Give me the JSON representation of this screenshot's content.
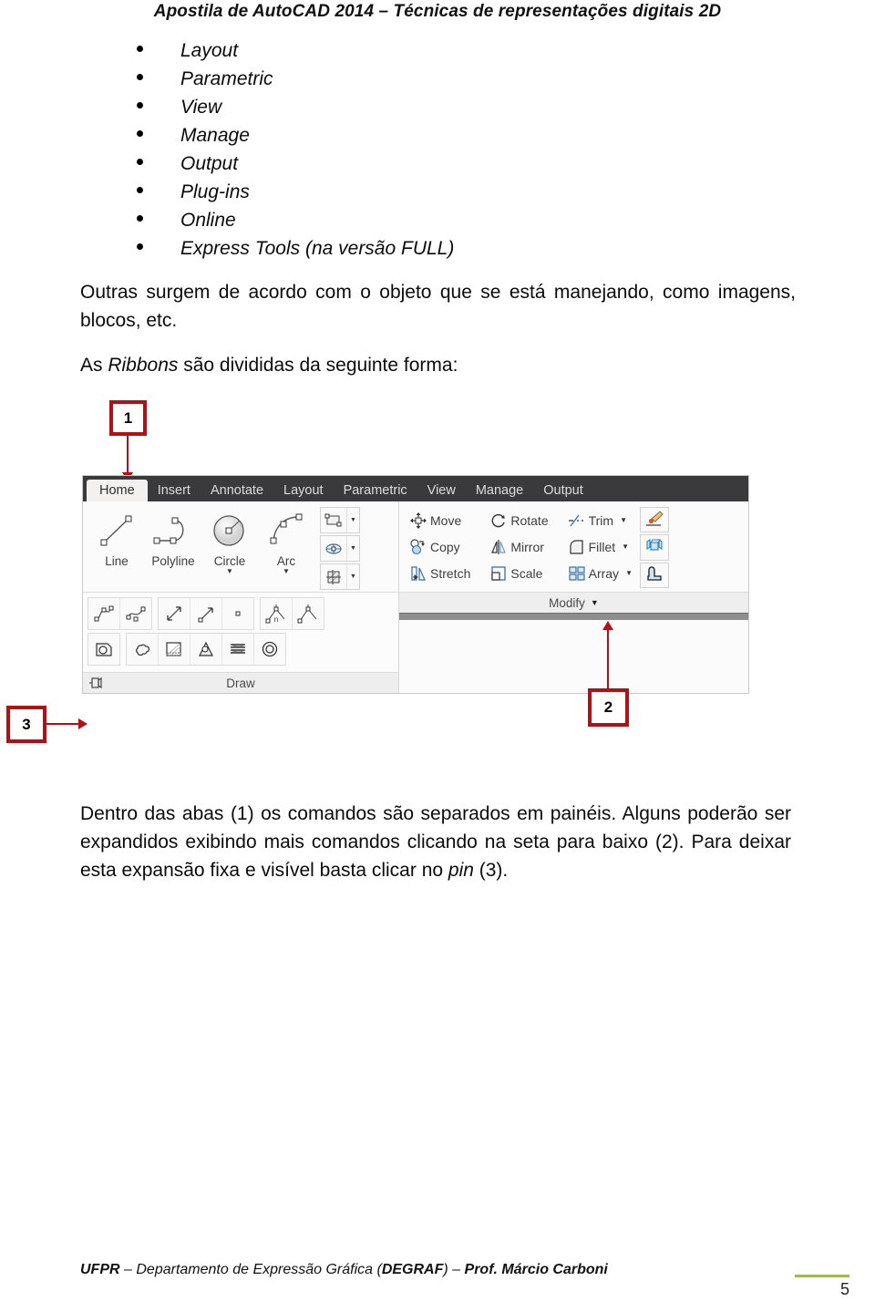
{
  "document": {
    "header": "Apostila de AutoCAD 2014 – Técnicas de representações digitais 2D",
    "footer": "UFPR – Departamento de Expressão Gráfica (DEGRAF) – Prof. Márcio Carboni",
    "footer_parts": {
      "inst": "UFPR",
      "sep1": " – ",
      "dept": "Departamento de Expressão Gráfica (",
      "acronym": "DEGRAF",
      "close": ")",
      "sep2": " – ",
      "author": "Prof. Márcio Carboni"
    },
    "page_number": "5",
    "accent_green": "#9bbb59",
    "callout_red": "#b01116"
  },
  "bullets": [
    {
      "label": "Layout"
    },
    {
      "label": "Parametric"
    },
    {
      "label": "View"
    },
    {
      "label": "Manage"
    },
    {
      "label": "Output"
    },
    {
      "label": "Plug-ins"
    },
    {
      "label": "Online"
    },
    {
      "label": "Express Tools (na versão FULL)"
    }
  ],
  "paragraphs": {
    "p1": "Outras surgem de acordo com o objeto que se está manejando, como imagens, blocos, etc.",
    "p2_pre": "As ",
    "p2_em": "Ribbons",
    "p2_post": " são divididas da seguinte forma:",
    "p3_a": "Dentro das abas (1) os comandos são separados em painéis. Alguns poderão ser expandidos exibindo mais comandos clicando na seta para baixo (2). Para deixar esta expansão fixa e visível basta clicar no ",
    "p3_em": "pin",
    "p3_b": " (3)."
  },
  "callouts": [
    {
      "id": "1",
      "label": "1",
      "points_to": "Home tab"
    },
    {
      "id": "2",
      "label": "2",
      "points_to": "Modify panel expand arrow"
    },
    {
      "id": "3",
      "label": "3",
      "points_to": "Draw panel pin"
    }
  ],
  "ribbon": {
    "tabs": [
      {
        "label": "Home",
        "active": true
      },
      {
        "label": "Insert",
        "active": false
      },
      {
        "label": "Annotate",
        "active": false
      },
      {
        "label": "Layout",
        "active": false
      },
      {
        "label": "Parametric",
        "active": false
      },
      {
        "label": "View",
        "active": false
      },
      {
        "label": "Manage",
        "active": false
      },
      {
        "label": "Output",
        "active": false
      }
    ],
    "draw_panel": {
      "title": "Draw",
      "big_tools": [
        {
          "label": "Line",
          "has_dropdown": false,
          "icon": "line-icon"
        },
        {
          "label": "Polyline",
          "has_dropdown": false,
          "icon": "polyline-icon"
        },
        {
          "label": "Circle",
          "has_dropdown": true,
          "icon": "circle-icon"
        },
        {
          "label": "Arc",
          "has_dropdown": true,
          "icon": "arc-icon"
        }
      ],
      "small_tools": [
        {
          "icon": "rectangle-icon",
          "has_dropdown": true
        },
        {
          "icon": "ellipse-icon",
          "has_dropdown": true
        },
        {
          "icon": "hatch-icon",
          "has_dropdown": true
        }
      ],
      "expanded_row1": [
        "spline-fit-icon",
        "spline-cv-icon",
        "construction-line-icon",
        "ray-icon",
        "point-icon",
        "divide-icon",
        "measure-icon"
      ],
      "expanded_row2": [
        "region-icon",
        "revision-cloud-icon",
        "wipeout-icon",
        "gradient-icon",
        "multiline-icon",
        "donut-icon"
      ],
      "pin_icon": "pin-icon"
    },
    "modify_panel": {
      "title": "Modify",
      "has_expand_arrow": true,
      "columns": [
        [
          {
            "label": "Move",
            "icon": "move-icon",
            "has_dropdown": false
          },
          {
            "label": "Copy",
            "icon": "copy-icon",
            "has_dropdown": false
          },
          {
            "label": "Stretch",
            "icon": "stretch-icon",
            "has_dropdown": false
          }
        ],
        [
          {
            "label": "Rotate",
            "icon": "rotate-icon",
            "has_dropdown": false
          },
          {
            "label": "Mirror",
            "icon": "mirror-icon",
            "has_dropdown": false
          },
          {
            "label": "Scale",
            "icon": "scale-icon",
            "has_dropdown": false
          }
        ],
        [
          {
            "label": "Trim",
            "icon": "trim-icon",
            "has_dropdown": true
          },
          {
            "label": "Fillet",
            "icon": "fillet-icon",
            "has_dropdown": true
          },
          {
            "label": "Array",
            "icon": "array-icon",
            "has_dropdown": true
          }
        ]
      ],
      "side_buttons": [
        {
          "icon": "match-properties-icon"
        },
        {
          "icon": "explode-icon"
        },
        {
          "icon": "chamfer-blend-icon"
        }
      ]
    }
  }
}
